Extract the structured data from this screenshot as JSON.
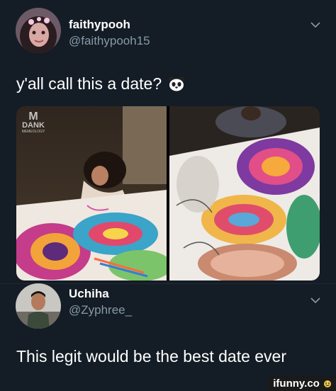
{
  "tweet1": {
    "display_name": "faithypooh",
    "handle": "@faithypooh15",
    "text": "y'all call this a date?",
    "emoji": "panda-face-emoji",
    "photo_overlay": {
      "brand": "DANK",
      "sub": "MEMEOLOGY"
    }
  },
  "tweet2": {
    "display_name": "Uchiha",
    "handle": "@Zyphree_",
    "text": "This legit would be the best date ever"
  },
  "watermark": "ifunny.co",
  "colors": {
    "background": "#141d26",
    "handle": "#8899a6",
    "text": "#ffffff"
  }
}
